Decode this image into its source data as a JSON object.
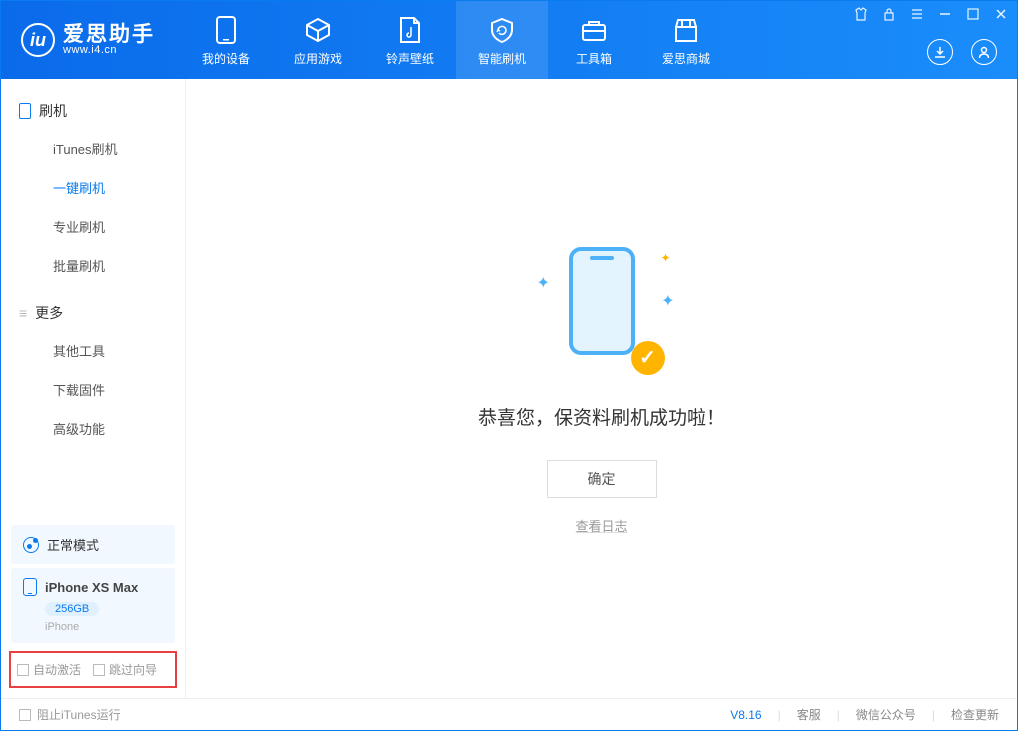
{
  "header": {
    "logo_title": "爱思助手",
    "logo_sub": "www.i4.cn",
    "nav": [
      {
        "label": "我的设备",
        "icon": "device"
      },
      {
        "label": "应用游戏",
        "icon": "cube"
      },
      {
        "label": "铃声壁纸",
        "icon": "music"
      },
      {
        "label": "智能刷机",
        "icon": "refresh",
        "active": true
      },
      {
        "label": "工具箱",
        "icon": "toolbox"
      },
      {
        "label": "爱思商城",
        "icon": "store"
      }
    ]
  },
  "sidebar": {
    "group1_title": "刷机",
    "group1_items": [
      {
        "label": "iTunes刷机"
      },
      {
        "label": "一键刷机",
        "active": true
      },
      {
        "label": "专业刷机"
      },
      {
        "label": "批量刷机"
      }
    ],
    "group2_title": "更多",
    "group2_items": [
      {
        "label": "其他工具"
      },
      {
        "label": "下载固件"
      },
      {
        "label": "高级功能"
      }
    ],
    "mode_label": "正常模式",
    "device": {
      "name": "iPhone XS Max",
      "storage": "256GB",
      "type": "iPhone"
    },
    "checkbox1": "自动激活",
    "checkbox2": "跳过向导"
  },
  "main": {
    "success_message": "恭喜您，保资料刷机成功啦！",
    "confirm_label": "确定",
    "view_log_label": "查看日志"
  },
  "footer": {
    "stop_itunes": "阻止iTunes运行",
    "version": "V8.16",
    "link1": "客服",
    "link2": "微信公众号",
    "link3": "检查更新"
  }
}
